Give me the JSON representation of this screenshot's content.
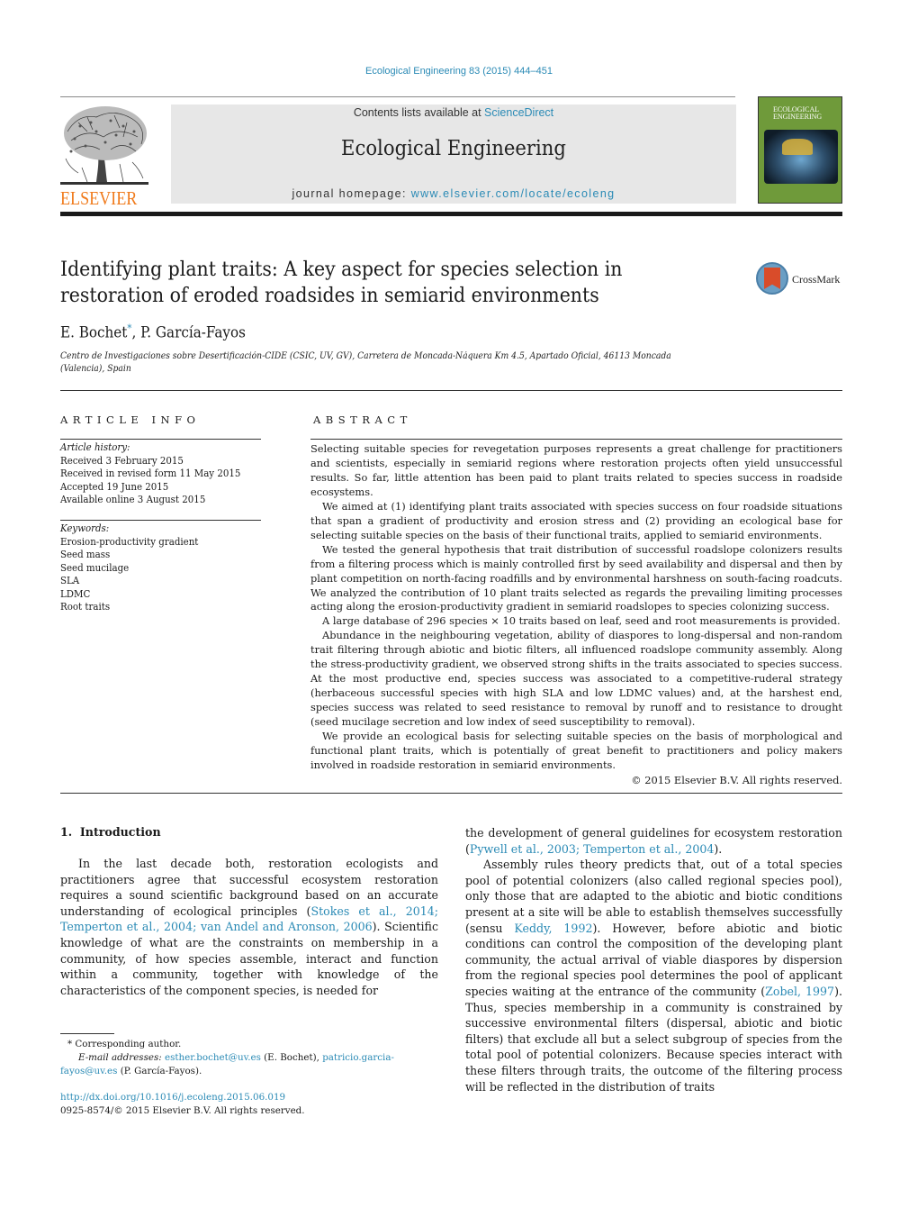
{
  "header": {
    "citation": "Ecological Engineering 83 (2015) 444–451",
    "publisher": "ELSEVIER",
    "contents_prefix": "Contents lists available at ",
    "contents_link": "ScienceDirect",
    "journal_name": "Ecological Engineering",
    "homepage_prefix": "journal homepage: ",
    "homepage_link": "www.elsevier.com/locate/ecoleng",
    "cover_title": "ECOLOGICAL ENGINEERING",
    "crossmark": "CrossMark"
  },
  "article": {
    "title": "Identifying plant traits: A key aspect for species selection in restoration of eroded roadsides in semiarid environments",
    "authors": [
      {
        "name": "E. Bochet",
        "marker": "*"
      },
      {
        "name": "P. García-Fayos"
      }
    ],
    "affiliation": "Centro de Investigaciones sobre Desertificación-CIDE (CSIC, UV, GV), Carretera de Moncada-Náquera Km 4.5, Apartado Oficial, 46113 Moncada (Valencia), Spain"
  },
  "article_info": {
    "heading": "ARTICLE INFO",
    "history_label": "Article history:",
    "history": [
      "Received 3 February 2015",
      "Received in revised form 11 May 2015",
      "Accepted 19 June 2015",
      "Available online 3 August 2015"
    ],
    "keywords_label": "Keywords:",
    "keywords": [
      "Erosion-productivity gradient",
      "Seed mass",
      "Seed mucilage",
      "SLA",
      "LDMC",
      "Root traits"
    ]
  },
  "abstract": {
    "heading": "ABSTRACT",
    "paragraphs": [
      "Selecting suitable species for revegetation purposes represents a great challenge for practitioners and scientists, especially in semiarid regions where restoration projects often yield unsuccessful results. So far, little attention has been paid to plant traits related to species success in roadside ecosystems.",
      "We aimed at (1) identifying plant traits associated with species success on four roadside situations that span a gradient of productivity and erosion stress and (2) providing an ecological base for selecting suitable species on the basis of their functional traits, applied to semiarid environments.",
      "We tested the general hypothesis that trait distribution of successful roadslope colonizers results from a filtering process which is mainly controlled first by seed availability and dispersal and then by plant competition on north-facing roadfills and by environmental harshness on south-facing roadcuts. We analyzed the contribution of 10 plant traits selected as regards the prevailing limiting processes acting along the erosion-productivity gradient in semiarid roadslopes to species colonizing success.",
      "A large database of 296 species × 10 traits based on leaf, seed and root measurements is provided.",
      "Abundance in the neighbouring vegetation, ability of diaspores to long-dispersal and non-random trait filtering through abiotic and biotic filters, all influenced roadslope community assembly. Along the stress-productivity gradient, we observed strong shifts in the traits associated to species success. At the most productive end, species success was associated to a competitive-ruderal strategy (herbaceous successful species with high SLA and low LDMC values) and, at the harshest end, species success was related to seed resistance to removal by runoff and to resistance to drought (seed mucilage secretion and low index of seed susceptibility to removal).",
      "We provide an ecological basis for selecting suitable species on the basis of morphological and functional plant traits, which is potentially of great benefit to practitioners and policy makers involved in roadside restoration in semiarid environments."
    ],
    "copyright": "© 2015 Elsevier B.V. All rights reserved."
  },
  "introduction": {
    "heading": "1.  Introduction",
    "left_p1_a": "In the last decade both, restoration ecologists and practitioners agree that successful ecosystem restoration requires a sound scientific background based on an accurate understanding of ecological principles (",
    "left_p1_cite": "Stokes et al., 2014; Temperton et al., 2004; van Andel and Aronson, 2006",
    "left_p1_b": "). Scientific knowledge of what are the constraints on membership in a community, of how species assemble, interact and function within a community, together with knowledge of the characteristics of the component species, is needed for",
    "right_p1_a": "the development of general guidelines for ecosystem restoration (",
    "right_p1_cite": "Pywell et al., 2003; Temperton et al., 2004",
    "right_p1_b": ").",
    "right_p2_a": "Assembly rules theory predicts that, out of a total species pool of potential colonizers (also called regional species pool), only those that are adapted to the abiotic and biotic conditions present at a site will be able to establish themselves successfully (sensu ",
    "right_p2_cite1": "Keddy, 1992",
    "right_p2_b": "). However, before abiotic and biotic conditions can control the composition of the developing plant community, the actual arrival of viable diaspores by dispersion from the regional species pool determines the pool of applicant species waiting at the entrance of the community (",
    "right_p2_cite2": "Zobel, 1997",
    "right_p2_c": "). Thus, species membership in a community is constrained by successive environmental filters (dispersal, abiotic and biotic filters) that exclude all but a select subgroup of species from the total pool of potential colonizers. Because species interact with these filters through traits, the outcome of the filtering process will be reflected in the distribution of traits"
  },
  "footnotes": {
    "corresponding": "* Corresponding author.",
    "email_label": "E-mail addresses: ",
    "email1": "esther.bochet@uv.es",
    "email1_name": " (E. Bochet), ",
    "email2": "patricio.garcia-fayos@uv.es",
    "email2_name": " (P. García-Fayos).",
    "doi": "http://dx.doi.org/10.1016/j.ecoleng.2015.06.019",
    "issn_copyright": "0925-8574/© 2015 Elsevier B.V. All rights reserved."
  }
}
